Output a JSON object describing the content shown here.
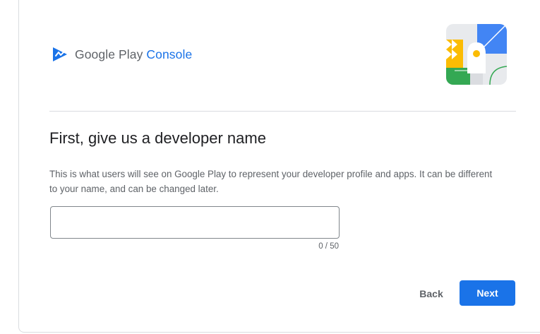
{
  "header": {
    "logo_google_play": "Google Play",
    "logo_console": "Console",
    "logo_icon": "play-console-icon",
    "hero_icon": "developer-illustration-icon"
  },
  "form": {
    "title": "First, give us a developer name",
    "description": "This is what users will see on Google Play to represent your developer profile and apps. It can be different to your name, and can be changed later.",
    "developer_name_value": "",
    "counter": "0 / 50"
  },
  "actions": {
    "back_label": "Back",
    "next_label": "Next"
  },
  "colors": {
    "accent": "#1a73e8",
    "text_primary": "#202124",
    "text_secondary": "#5f6368",
    "divider": "#dadce0"
  }
}
